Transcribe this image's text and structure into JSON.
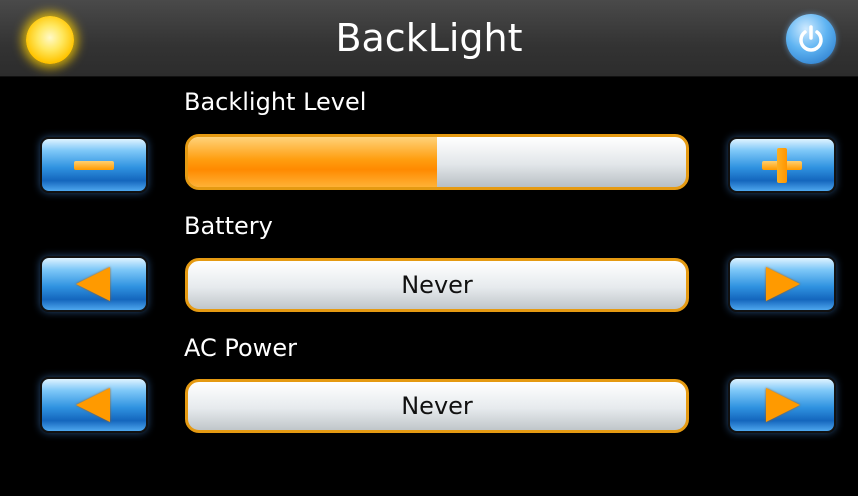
{
  "header": {
    "title": "BackLight",
    "left_icon": "sun-icon",
    "right_icon": "power-icon"
  },
  "backlight": {
    "label": "Backlight Level",
    "level_fraction": 0.5,
    "decrease_icon": "minus-icon",
    "increase_icon": "plus-icon"
  },
  "battery": {
    "label": "Battery",
    "value": "Never",
    "prev_icon": "left-arrow-icon",
    "next_icon": "right-arrow-icon"
  },
  "ac_power": {
    "label": "AC Power",
    "value": "Never",
    "prev_icon": "left-arrow-icon",
    "next_icon": "right-arrow-icon"
  },
  "colors": {
    "accent_orange": "#ff9a00",
    "button_blue": "#2f92e0",
    "background": "#000000",
    "header_bg": "#3a3a3a"
  }
}
